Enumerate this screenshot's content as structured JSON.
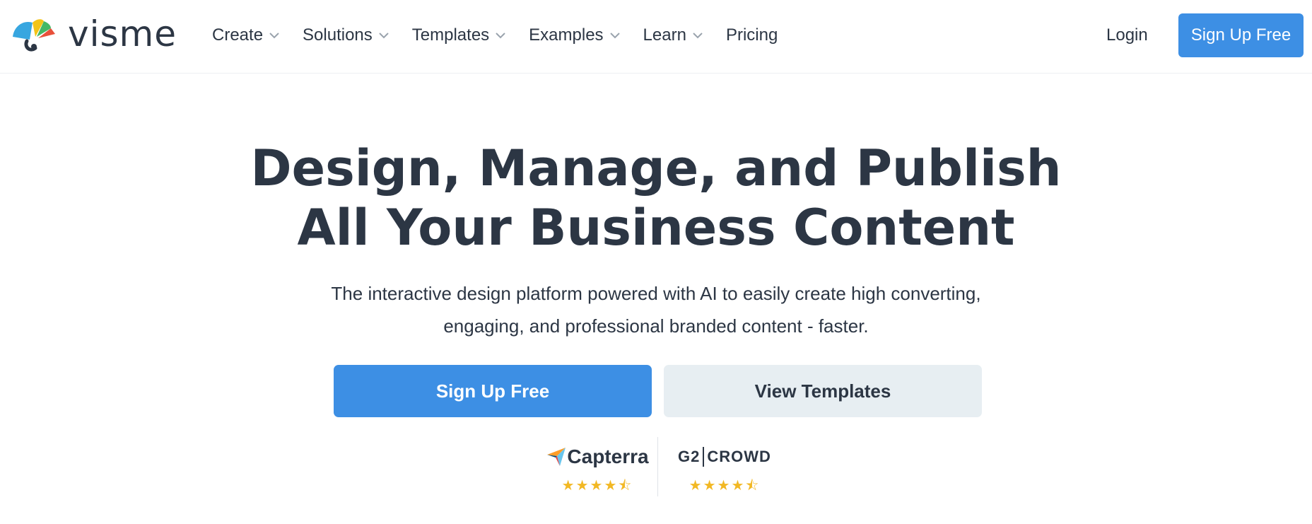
{
  "brand": {
    "name": "visme",
    "accent": "#3d8fe4"
  },
  "nav": {
    "items": [
      {
        "label": "Create",
        "has_dropdown": true
      },
      {
        "label": "Solutions",
        "has_dropdown": true
      },
      {
        "label": "Templates",
        "has_dropdown": true
      },
      {
        "label": "Examples",
        "has_dropdown": true
      },
      {
        "label": "Learn",
        "has_dropdown": true
      },
      {
        "label": "Pricing",
        "has_dropdown": false
      }
    ],
    "login_label": "Login",
    "signup_label": "Sign Up Free"
  },
  "hero": {
    "title_line1": "Design, Manage, and Publish",
    "title_line2": "All Your Business Content",
    "subtitle": "The interactive design platform powered with AI to easily create high converting, engaging, and professional branded content - faster.",
    "primary_button": "Sign Up Free",
    "secondary_button": "View Templates"
  },
  "ratings": [
    {
      "name": "Capterra",
      "stars": "★★★★⯪",
      "value": 4.5
    },
    {
      "name": "G2",
      "suffix": "CROWD",
      "stars": "★★★★⯪",
      "value": 4.5
    }
  ]
}
